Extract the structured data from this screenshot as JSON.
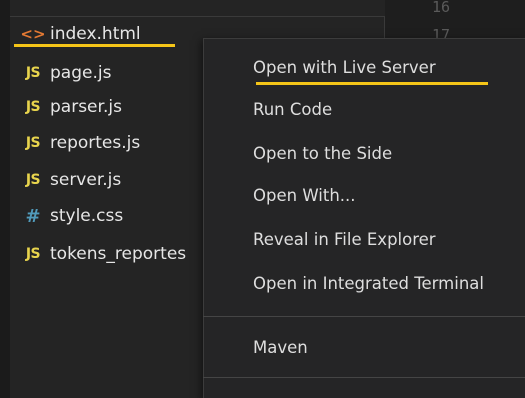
{
  "editor": {
    "line_numbers": [
      "16",
      "17"
    ]
  },
  "explorer": {
    "files": [
      {
        "name": "index.html",
        "icon": "html-icon",
        "icon_glyph": "<>"
      },
      {
        "name": "page.js",
        "icon": "js-icon",
        "icon_glyph": "JS"
      },
      {
        "name": "parser.js",
        "icon": "js-icon",
        "icon_glyph": "JS"
      },
      {
        "name": "reportes.js",
        "icon": "js-icon",
        "icon_glyph": "JS"
      },
      {
        "name": "server.js",
        "icon": "js-icon",
        "icon_glyph": "JS"
      },
      {
        "name": "style.css",
        "icon": "css-icon",
        "icon_glyph": "#"
      },
      {
        "name": "tokens_reportes",
        "icon": "js-icon",
        "icon_glyph": "JS"
      }
    ]
  },
  "context_menu": {
    "items": [
      {
        "label": "Open with Live Server"
      },
      {
        "label": "Run Code"
      },
      {
        "label": "Open to the Side"
      },
      {
        "label": "Open With..."
      },
      {
        "label": "Reveal in File Explorer"
      },
      {
        "label": "Open in Integrated Terminal"
      },
      {
        "label": "Maven"
      }
    ]
  },
  "colors": {
    "highlight_underline": "#f5c518",
    "js_icon": "#e8d44d",
    "css_icon": "#519aba",
    "html_icon": "#e37933"
  }
}
